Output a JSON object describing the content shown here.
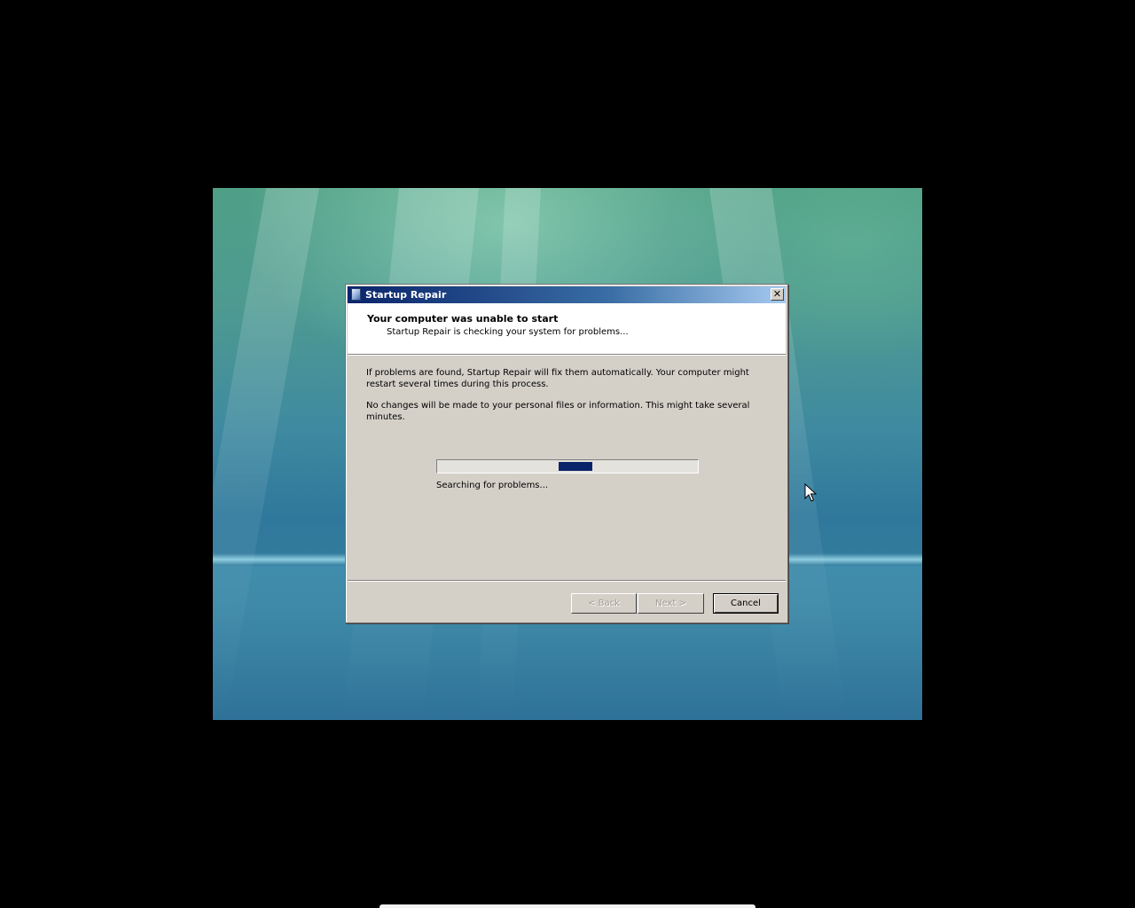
{
  "dialog": {
    "title": "Startup Repair",
    "close_glyph": "✕",
    "heading": "Your computer was unable to start",
    "subheading": "Startup Repair is checking your system for problems...",
    "paragraph1": "If problems are found, Startup Repair will fix them automatically. Your computer might restart several times during this process.",
    "paragraph2": "No changes will be made to your personal files or information. This might take several minutes.",
    "status": "Searching for problems...",
    "progress": {
      "mode": "marquee",
      "segment_position_fraction": 0.47,
      "segment_width_fraction": 0.13,
      "color": "#0a246a"
    },
    "buttons": {
      "back": "< Back",
      "next": "Next >",
      "cancel": "Cancel"
    }
  },
  "icons": {
    "title": "startup-repair-icon",
    "close": "close-icon",
    "cursor": "mouse-pointer-icon"
  },
  "colors": {
    "titlebar_start": "#0a246a",
    "titlebar_end": "#a6caf0",
    "dialog_face": "#d4d0c8"
  }
}
